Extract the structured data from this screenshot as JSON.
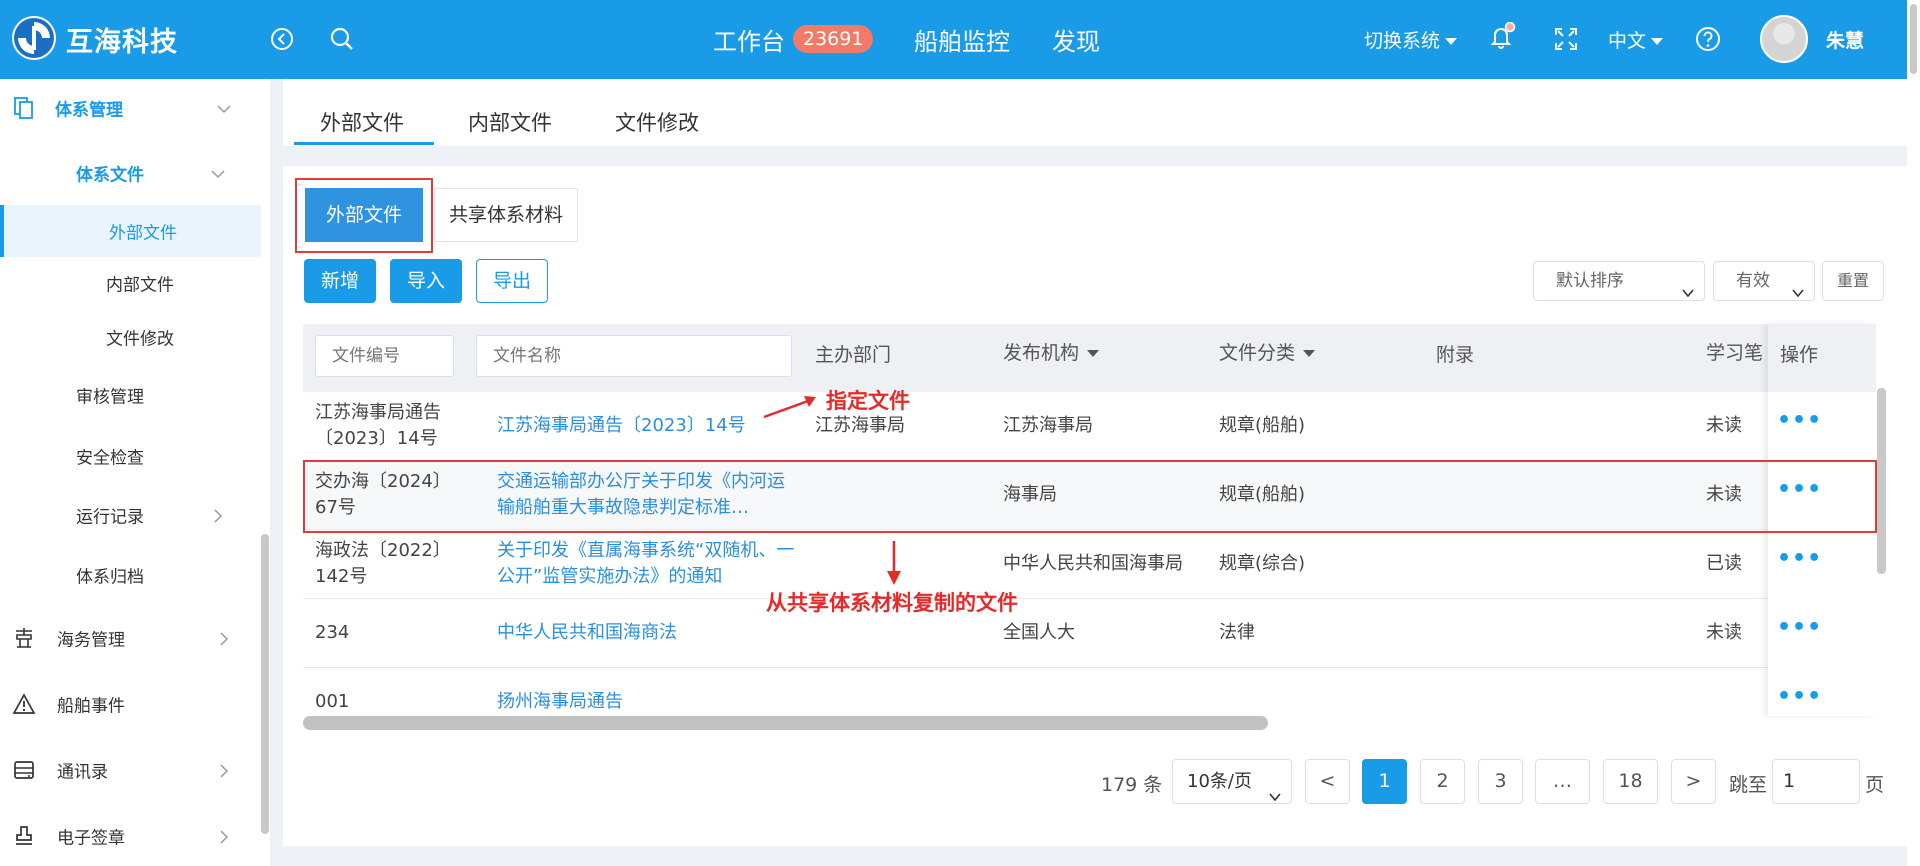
{
  "header": {
    "brand": "互海科技",
    "nav": [
      {
        "label": "工作台",
        "badge": "23691"
      },
      {
        "label": "船舶监控"
      },
      {
        "label": "发现"
      }
    ],
    "switch_system": "切换系统",
    "language": "中文",
    "user": "朱慧",
    "colors": {
      "primary": "#1a9be8",
      "badge": "#f27a67"
    }
  },
  "sidebar": {
    "group": "体系管理",
    "subgroup": "体系文件",
    "sub_items": [
      "外部文件",
      "内部文件",
      "文件修改"
    ],
    "items": [
      "审核管理",
      "安全检查",
      "运行记录",
      "体系归档"
    ],
    "modules": [
      "海务管理",
      "船舶事件",
      "通讯录",
      "电子签章"
    ]
  },
  "top_tabs": [
    "外部文件",
    "内部文件",
    "文件修改"
  ],
  "segments": {
    "active": "外部文件",
    "other": "共享体系材料"
  },
  "toolbar": {
    "add": "新增",
    "import": "导入",
    "export": "导出",
    "sort_select": "默认排序",
    "status_select": "有效",
    "reset": "重置"
  },
  "table": {
    "filters": {
      "doc_no_placeholder": "文件编号",
      "doc_name_placeholder": "文件名称"
    },
    "headers": {
      "dept": "主办部门",
      "issuer": "发布机构",
      "category": "文件分类",
      "appendix": "附录",
      "study": "学习笔",
      "action": "操作"
    },
    "rows": [
      {
        "no": "江苏海事局通告〔2023〕14号",
        "name": "江苏海事局通告〔2023〕14号",
        "dept": "江苏海事局",
        "issuer": "江苏海事局",
        "category": "规章(船舶)",
        "status": "未读"
      },
      {
        "no": "交办海〔2024〕67号",
        "name": "交通运输部办公厅关于印发《内河运输船舶重大事故隐患判定标准…",
        "dept": "",
        "issuer": "海事局",
        "category": "规章(船舶)",
        "status": "未读"
      },
      {
        "no": "海政法〔2022〕142号",
        "name": "关于印发《直属海事系统“双随机、一公开”监管实施办法》的通知",
        "dept": "",
        "issuer": "中华人民共和国海事局",
        "category": "规章(综合)",
        "status": "已读"
      },
      {
        "no": "234",
        "name": "中华人民共和国海商法",
        "dept": "",
        "issuer": "全国人大",
        "category": "法律",
        "status": "未读"
      },
      {
        "no": "001",
        "name": "扬州海事局通告",
        "dept": "",
        "issuer": "",
        "category": "",
        "status": ""
      }
    ],
    "action_glyph": "•••"
  },
  "annotations": {
    "specified": "指定文件",
    "copied": "从共享体系材料复制的文件",
    "color": "#e52a2a"
  },
  "pagination": {
    "total": "179 条",
    "page_size": "10条/页",
    "prev": "<",
    "pages": [
      "1",
      "2",
      "3",
      "…",
      "18"
    ],
    "current": "1",
    "next": ">",
    "jump_label": "跳至",
    "jump_value": "1",
    "unit": "页"
  }
}
